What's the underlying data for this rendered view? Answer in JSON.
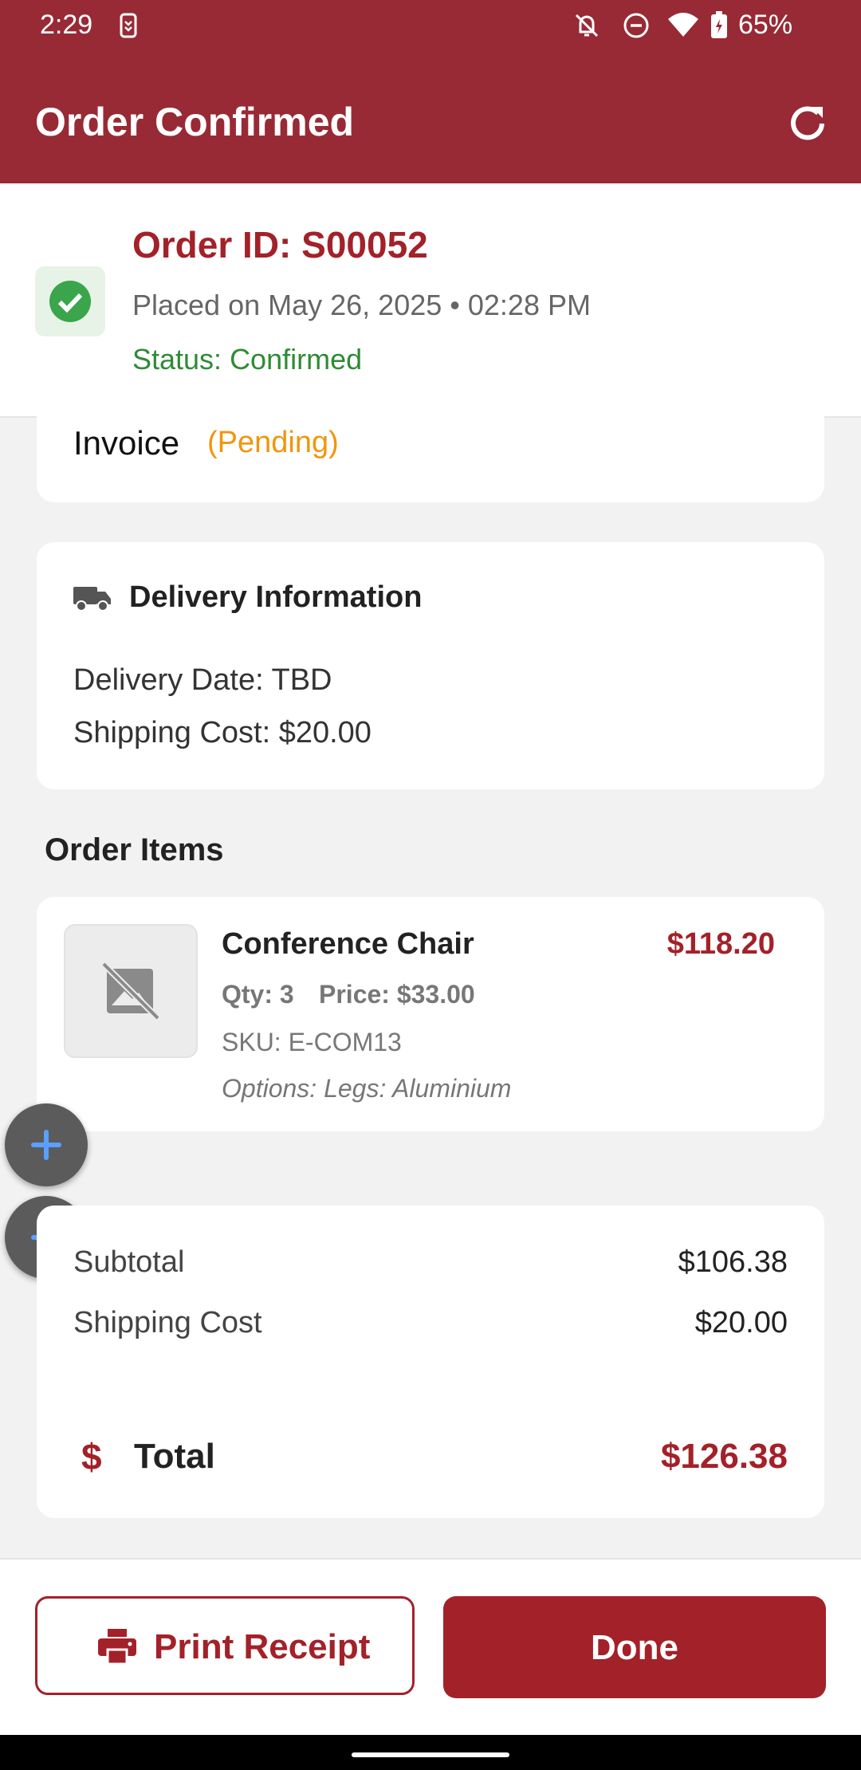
{
  "status_bar": {
    "time": "2:29",
    "battery": "65%"
  },
  "app_bar": {
    "title": "Order Confirmed"
  },
  "order": {
    "id_label": "Order ID: S00052",
    "placed": "Placed on May 26, 2025 • 02:28 PM",
    "status": "Status: Confirmed"
  },
  "invoice": {
    "label": "Invoice",
    "state": "(Pending)"
  },
  "delivery": {
    "title": "Delivery Information",
    "date": "Delivery Date: TBD",
    "shipping": "Shipping Cost: $20.00"
  },
  "items_heading": "Order Items",
  "items": [
    {
      "name": "Conference Chair",
      "total": "$118.20",
      "qty": "Qty: 3",
      "price": "Price: $33.00",
      "sku": "SKU: E-COM13",
      "options": "Options: Legs: Aluminium"
    }
  ],
  "summary": {
    "subtotal_label": "Subtotal",
    "subtotal_value": "$106.38",
    "shipping_label": "Shipping Cost",
    "shipping_value": "$20.00",
    "total_symbol": "$",
    "total_label": "Total",
    "total_value": "$126.38"
  },
  "actions": {
    "print": "Print Receipt",
    "done": "Done"
  },
  "colors": {
    "primary": "#982a35",
    "accent_red": "#a32129",
    "success": "#2e8b35",
    "pending": "#f0960c"
  },
  "icons": [
    "vibrate-icon",
    "bell-off-icon",
    "dnd-icon",
    "wifi-icon",
    "battery-icon",
    "refresh-icon",
    "check-icon",
    "truck-icon",
    "image-off-icon",
    "plus-icon",
    "minus-icon",
    "printer-icon"
  ]
}
